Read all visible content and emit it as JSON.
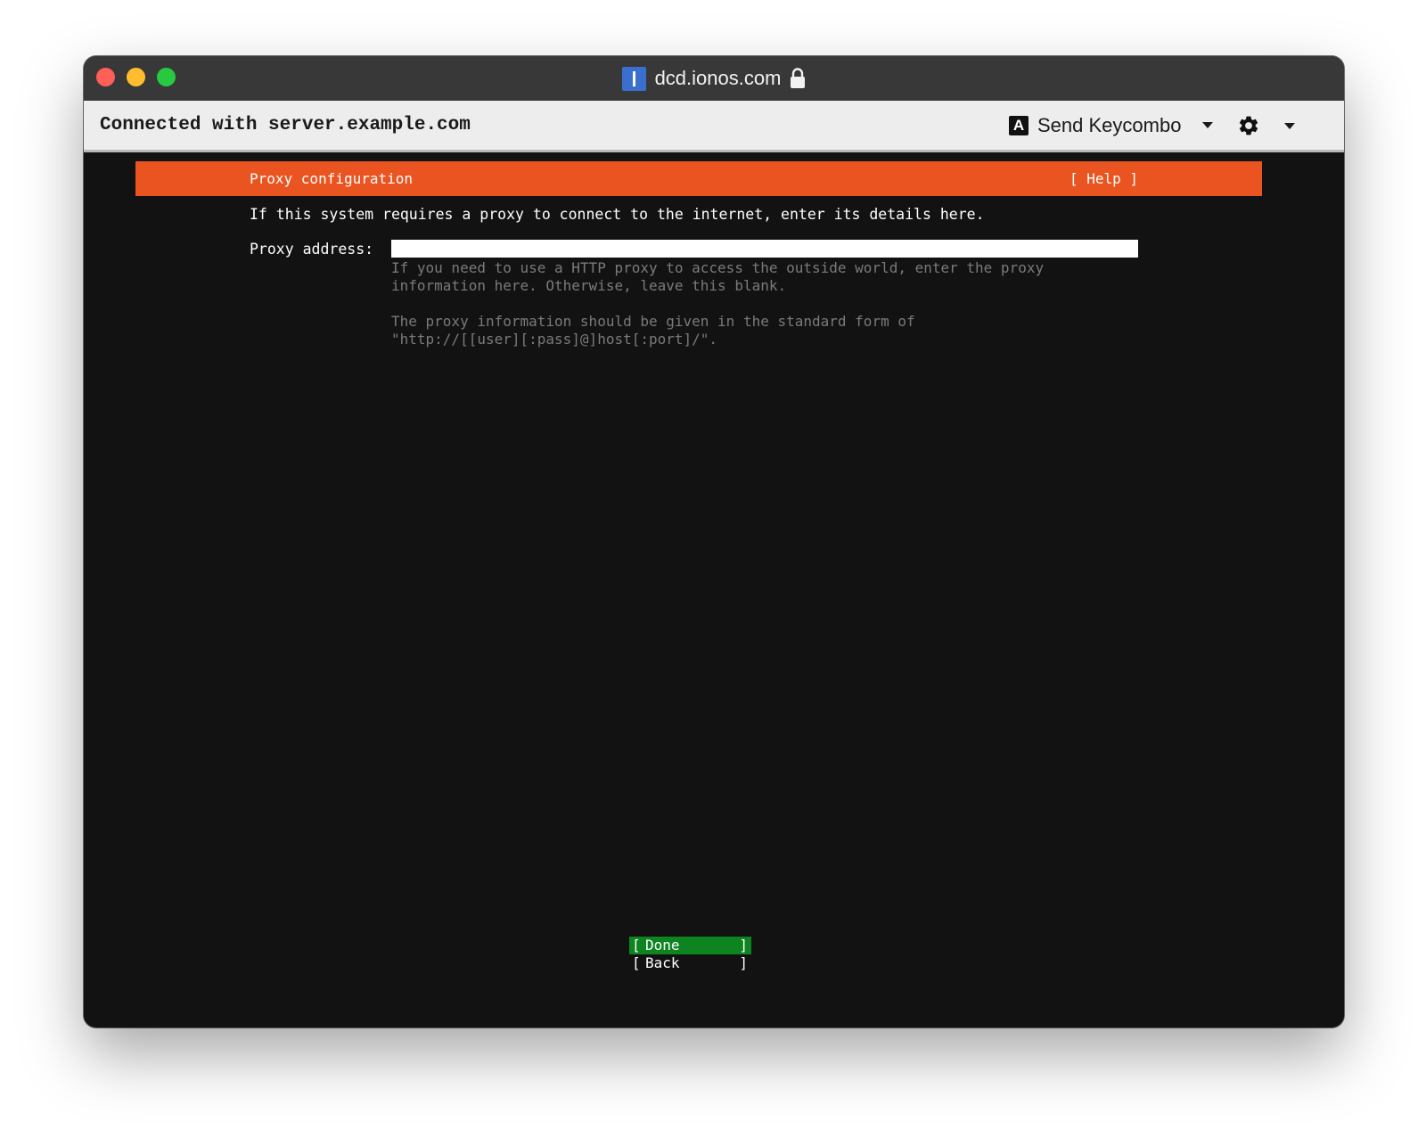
{
  "window": {
    "domain": "dcd.ionos.com"
  },
  "toolbar": {
    "connection_text": "Connected with server.example.com",
    "keycombo_icon_letter": "A",
    "keycombo_label": "Send Keycombo",
    "icons": [
      "keycombo-a-icon",
      "chevron-down-icon",
      "gear-icon",
      "chevron-down-icon"
    ]
  },
  "installer": {
    "header_title": "Proxy configuration",
    "help_label": "[ Help ]",
    "intro_text": "If this system requires a proxy to connect to the internet, enter its details here.",
    "proxy_label": "Proxy address:",
    "proxy_value": "",
    "hint_paragraph_1": "If you need to use a HTTP proxy to access the outside world, enter the proxy\ninformation here. Otherwise, leave this blank.",
    "hint_paragraph_2": "The proxy information should be given in the standard form of\n\"http://[[user][:pass]@]host[:port]/\".",
    "buttons": {
      "open_bracket": "[",
      "close_bracket": "]",
      "done_label": "Done",
      "back_label": "Back"
    }
  },
  "colors": {
    "header_orange": "#e95420",
    "done_green": "#0e8420",
    "console_bg": "#121212",
    "hint_gray": "#7a7a7a",
    "titlebar_bg": "#383838",
    "toolbar_bg": "#ededed",
    "favicon_blue": "#3b6fcf"
  }
}
